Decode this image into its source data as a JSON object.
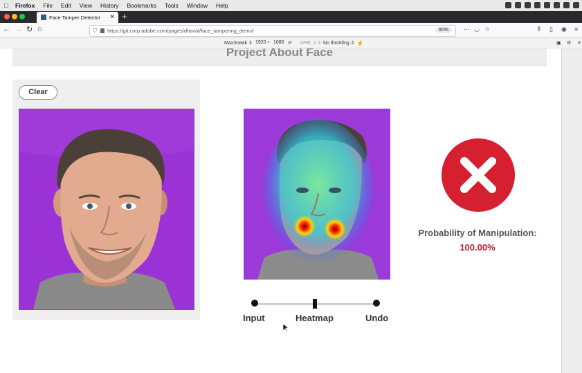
{
  "menubar": {
    "app": "Firefox",
    "items": [
      "File",
      "Edit",
      "View",
      "History",
      "Bookmarks",
      "Tools",
      "Window",
      "Help"
    ]
  },
  "tab": {
    "title": "Face Tamper Detector"
  },
  "url": {
    "value": "https://git.corp.adobe.com/pages/dhaval/face_tampering_demo/",
    "zoom": "80%"
  },
  "rdm": {
    "device": "MaxSneak ⇕",
    "width": "1920",
    "x": "×",
    "height": "1080",
    "dpr": "DPR: 2 ⇕",
    "throttling": "No throttling ⇕"
  },
  "page": {
    "title": "Project About Face",
    "clear_label": "Clear",
    "slider": {
      "input": "Input",
      "heatmap": "Heatmap",
      "undo": "Undo"
    },
    "probability_label": "Probability of Manipulation:",
    "probability_value": "100.00%"
  },
  "icons": {
    "back": "back-arrow-icon",
    "forward": "forward-arrow-icon",
    "reload": "reload-icon",
    "home": "home-icon",
    "result": "x-mark-icon"
  },
  "colors": {
    "accent_red": "#d62030",
    "value_red": "#c0202e",
    "photo_bg": "#9b32d6"
  }
}
